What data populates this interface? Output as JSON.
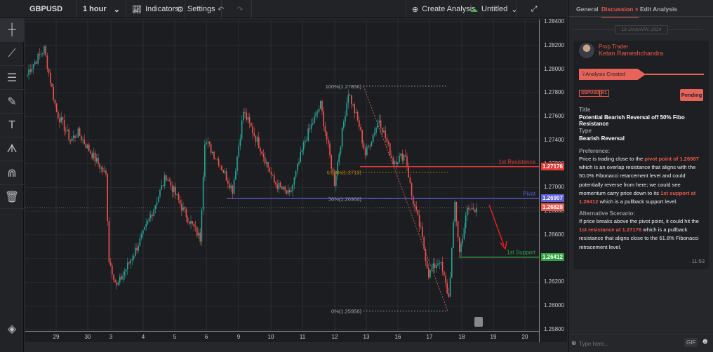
{
  "toolbar": {
    "symbol": "GBPUSD",
    "interval": "1 hour",
    "indicators": "Indicators",
    "settings": "Settings",
    "create_analysis": "Create Analysis",
    "save_name": "Untitled"
  },
  "left_tools": [
    "crosshair",
    "trend-line",
    "horizontal-lines",
    "brush",
    "text",
    "pattern",
    "magnet",
    "trash"
  ],
  "chart_data": {
    "type": "candlestick",
    "symbol": "GBPUSD",
    "timeframe": "1 hour",
    "ylim": [
      1.258,
      1.2845
    ],
    "y_ticks": [
      "1.28400",
      "1.28200",
      "1.28000",
      "1.27800",
      "1.27600",
      "1.27400",
      "1.27200",
      "1.27000",
      "1.26800",
      "1.26600",
      "1.26400",
      "1.26200",
      "1.26000",
      "1.25800"
    ],
    "x_ticks": [
      "29",
      "30",
      "3",
      "4",
      "5",
      "6",
      "9",
      "10",
      "11",
      "12",
      "13",
      "16",
      "17",
      "18",
      "19",
      "20"
    ],
    "price_path": [
      [
        0,
        1.2795
      ],
      [
        1,
        1.2799
      ],
      [
        11,
        1.2817
      ],
      [
        15,
        1.279
      ],
      [
        19,
        1.2764
      ],
      [
        28,
        1.274
      ],
      [
        33,
        1.2746
      ],
      [
        51,
        1.271
      ],
      [
        53,
        1.2639
      ],
      [
        58,
        1.2616
      ],
      [
        67,
        1.2639
      ],
      [
        76,
        1.2663
      ],
      [
        90,
        1.271
      ],
      [
        101,
        1.2681
      ],
      [
        112,
        1.2657
      ],
      [
        115,
        1.274
      ],
      [
        124,
        1.2722
      ],
      [
        133,
        1.2698
      ],
      [
        140,
        1.2764
      ],
      [
        151,
        1.2734
      ],
      [
        160,
        1.2704
      ],
      [
        170,
        1.2693
      ],
      [
        180,
        1.274
      ],
      [
        190,
        1.277
      ],
      [
        199,
        1.2704
      ],
      [
        208,
        1.2781
      ],
      [
        215,
        1.2752
      ],
      [
        219,
        1.2728
      ],
      [
        228,
        1.2758
      ],
      [
        237,
        1.2722
      ],
      [
        245,
        1.2728
      ],
      [
        249,
        1.2693
      ],
      [
        255,
        1.2663
      ],
      [
        260,
        1.2627
      ],
      [
        267,
        1.2639
      ],
      [
        273,
        1.2607
      ],
      [
        277,
        1.2687
      ],
      [
        280,
        1.2645
      ],
      [
        285,
        1.2681
      ],
      [
        291,
        1.26828
      ]
    ],
    "levels": [
      {
        "label": "1st Resistance",
        "price": "1.27176",
        "value": 1.27176,
        "color": "#e53935"
      },
      {
        "label": "Pivot",
        "price": "1.26907",
        "value": 1.26907,
        "color": "#5c5fd6"
      },
      {
        "label": "1st Support",
        "price": "1.26412",
        "value": 1.26412,
        "color": "#2ea043"
      }
    ],
    "current_price": {
      "price": "1.26828",
      "value": 1.26828,
      "color": "#e8584a"
    },
    "fibonacci": [
      {
        "label": "100%(1.27856)",
        "value": 1.27856,
        "color": "#aaaaaa"
      },
      {
        "label": "61.8%(1.2713)",
        "value": 1.2713,
        "color": "#b8860b"
      },
      {
        "label": "50%(1.26906)",
        "value": 1.26906,
        "color": "#aaaaaa"
      },
      {
        "label": "0%(1.25956)",
        "value": 1.25956,
        "color": "#aaaaaa"
      }
    ],
    "colors": {
      "up": "#26a69a",
      "down": "#ef5350"
    }
  },
  "panel": {
    "tabs": [
      "General",
      "Discussion",
      "Edit Analysis"
    ],
    "active_tab": "Discussion",
    "date": "18 JANUARY, 2024",
    "author_role": "Prop Trader",
    "author_name": "Ketan Rameshchandra",
    "event": "Analysis Created",
    "tags": [
      "GBPUSD",
      "H1"
    ],
    "status": "Pending",
    "title_label": "Title",
    "title": "Potential Bearish Reversal off 50% Fibo Resistance",
    "type_label": "Type",
    "type": "Bearish Reversal",
    "preference_label": "Preference:",
    "preference": [
      "Price is trading close to the ",
      "pivot point of 1.26907",
      " which is an overlap resistance that aligns with the 50.0% Fibonacci retarcement level and could potentially reverse from here; we could see momentum carry price down to its ",
      "1st support at 1.26412",
      " which is a pullback support level."
    ],
    "alt_label": "Alternative Scenario:",
    "alt": [
      "If price breaks above the pivot point, it could hit the ",
      "1st resistance at 1.27176",
      " which is a pullback resistance that aligns close to the 61.8% Fibonacci retracement level."
    ],
    "time": "11:53",
    "input_placeholder": "Type here...",
    "gif": "GIF",
    "accent": "#e8584a"
  }
}
